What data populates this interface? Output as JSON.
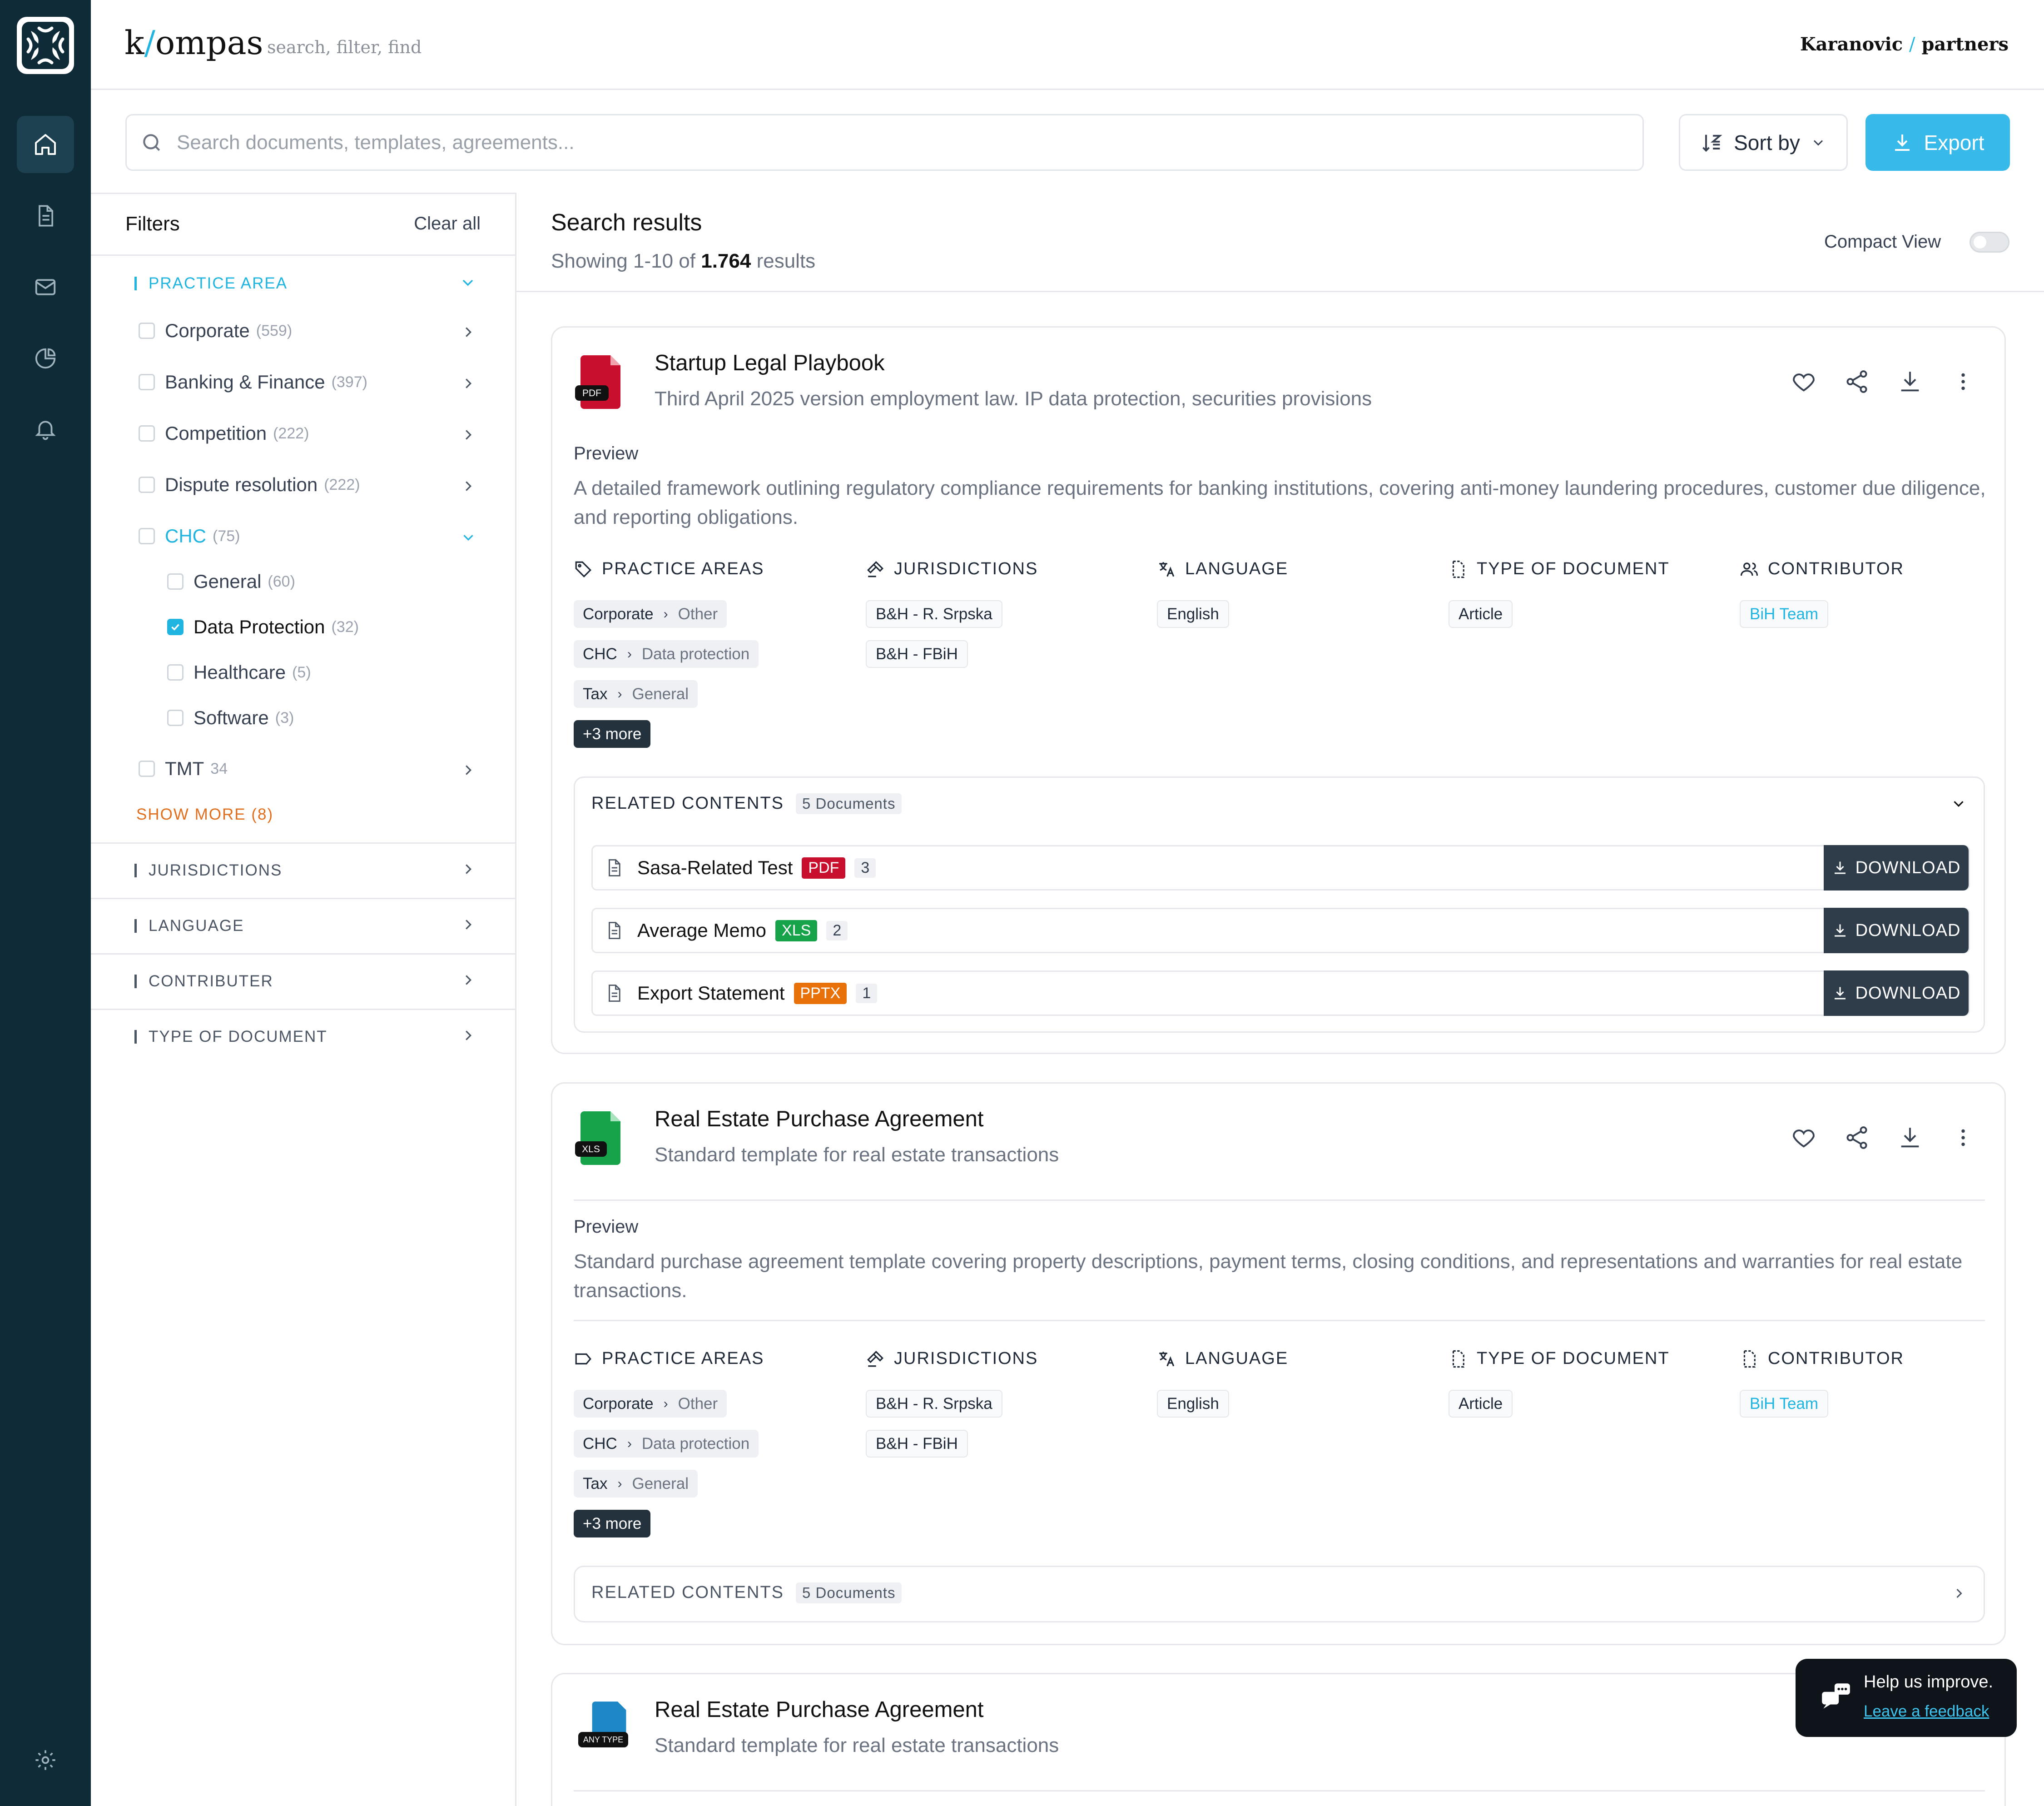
{
  "app": {
    "brand_k": "k",
    "brand_slash": "/",
    "brand_rest": "ompas",
    "tagline": "search, filter, find",
    "firm_left": "Karanovic",
    "firm_slash": "/",
    "firm_right": "partners"
  },
  "nav": [
    "home-icon",
    "document-icon",
    "mail-icon",
    "chart-icon",
    "bell-icon",
    "settings-icon"
  ],
  "search": {
    "placeholder": "Search documents, templates, agreements..."
  },
  "toolbar": {
    "sort_label": "Sort by",
    "export_label": "Export"
  },
  "colors": {
    "accent": "#37b9e9",
    "rail": "#0f2b38",
    "pdf": "#c8102e",
    "xls": "#16a34a",
    "pptx": "#e8710a",
    "any": "#1e88c7"
  },
  "filters": {
    "title": "Filters",
    "clear_all": "Clear all",
    "practice_area": {
      "label": "PRACTICE AREA",
      "items": [
        {
          "label": "Corporate",
          "count": "(559)"
        },
        {
          "label": "Banking & Finance",
          "count": "(397)"
        },
        {
          "label": "Competition",
          "count": "(222)"
        },
        {
          "label": "Dispute resolution",
          "count": "(222)"
        },
        {
          "label": "CHC",
          "count": "(75)"
        },
        {
          "label": "TMT",
          "count": "34"
        }
      ],
      "chc_children": [
        {
          "label": "General",
          "count": "(60)",
          "checked": false
        },
        {
          "label": "Data Protection",
          "count": "(32)",
          "checked": true
        },
        {
          "label": "Healthcare",
          "count": "(5)",
          "checked": false
        },
        {
          "label": "Software",
          "count": "(3)",
          "checked": false
        }
      ],
      "show_more": "SHOW MORE (8)"
    },
    "sections": [
      "JURISDICTIONS",
      "LANGUAGE",
      "CONTRIBUTER",
      "TYPE OF DOCUMENT"
    ]
  },
  "results": {
    "title": "Search results",
    "showing_prefix": "Showing 1-10 of",
    "total": "1.764",
    "showing_suffix": "results",
    "compact_view": "Compact View",
    "compact_on": false
  },
  "meta_headers": [
    "PRACTICE AREAS",
    "JURISDICTIONS",
    "LANGUAGE",
    "TYPE OF DOCUMENT",
    "CONTRIBUTOR"
  ],
  "cards": [
    {
      "file_type": "PDF",
      "title": "Startup Legal Playbook",
      "subtitle": "Third April 2025 version employment law. IP data protection, securities provisions",
      "preview_label": "Preview",
      "preview": "A detailed framework outlining regulatory compliance requirements for banking institutions, covering anti-money laundering procedures, customer due diligence, and reporting obligations.",
      "practice_areas": [
        {
          "main": "Corporate",
          "sub": "Other"
        },
        {
          "main": "CHC",
          "sub": "Data protection"
        },
        {
          "main": "Tax",
          "sub": "General"
        }
      ],
      "more": "+3 more",
      "jurisdictions": [
        "B&H - R. Srpska",
        "B&H - FBiH"
      ],
      "language": "English",
      "doc_type": "Article",
      "contributor": "BiH Team",
      "related": {
        "label": "RELATED CONTENTS",
        "count": "5 Documents",
        "expanded": true,
        "items": [
          {
            "name": "Sasa-Related Test",
            "type": "PDF",
            "n": "3"
          },
          {
            "name": "Average Memo",
            "type": "XLS",
            "n": "2"
          },
          {
            "name": "Export Statement",
            "type": "PPTX",
            "n": "1"
          }
        ],
        "download_label": "DOWNLOAD"
      }
    },
    {
      "file_type": "XLS",
      "title": "Real Estate Purchase Agreement",
      "subtitle": "Standard template for real estate transactions",
      "preview_label": "Preview",
      "preview": "Standard purchase agreement template covering property descriptions, payment terms, closing conditions, and representations and warranties for real estate transactions.",
      "practice_areas": [
        {
          "main": "Corporate",
          "sub": "Other"
        },
        {
          "main": "CHC",
          "sub": "Data protection"
        },
        {
          "main": "Tax",
          "sub": "General"
        }
      ],
      "more": "+3 more",
      "jurisdictions": [
        "B&H - R. Srpska",
        "B&H - FBiH"
      ],
      "language": "English",
      "doc_type": "Article",
      "contributor": "BiH Team",
      "related": {
        "label": "RELATED CONTENTS",
        "count": "5 Documents",
        "expanded": false
      }
    },
    {
      "file_type": "ANY TYPE",
      "title": "Real Estate Purchase Agreement",
      "subtitle": "Standard template for real estate transactions"
    }
  ],
  "toast": {
    "text": "Help us improve.",
    "link": "Leave a feedback"
  }
}
